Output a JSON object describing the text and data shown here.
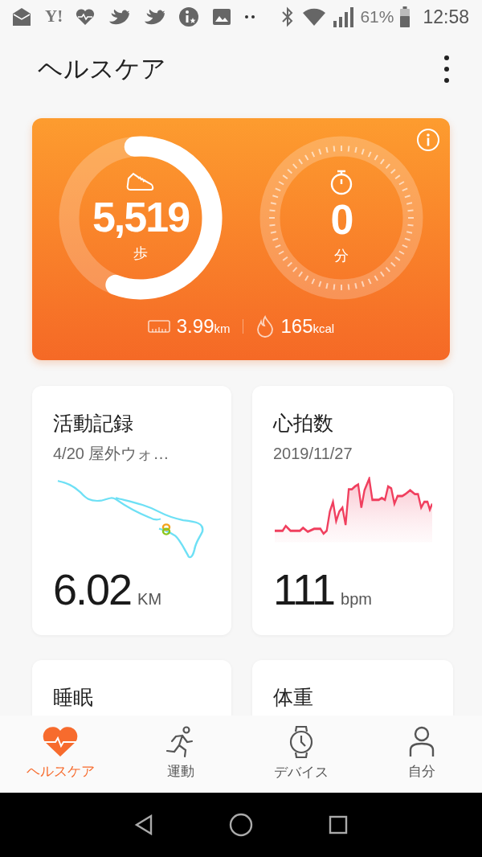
{
  "status_bar": {
    "logo_text": "Y!",
    "battery": "61%",
    "time": "12:58"
  },
  "header": {
    "title": "ヘルスケア"
  },
  "summary": {
    "steps": "5,519",
    "steps_unit": "歩",
    "steps_progress": {
      "level": 0.57
    },
    "minutes": "0",
    "minutes_unit": "分",
    "distance": "3.99",
    "distance_unit": "km",
    "calories": "165",
    "calories_unit": "kcal"
  },
  "cards": [
    {
      "kind": "route",
      "title": "活動記録",
      "subtitle": "4/20 屋外ウォ…",
      "value": "6.02",
      "unit": "KM"
    },
    {
      "kind": "heart",
      "title": "心拍数",
      "subtitle": "2019/11/27",
      "value": "111",
      "unit": "bpm"
    },
    {
      "kind": "plain",
      "title": "睡眠"
    },
    {
      "kind": "plain",
      "title": "体重"
    }
  ],
  "tabs": [
    {
      "kind": "health",
      "label": "ヘルスケア",
      "selected": true
    },
    {
      "kind": "exercise",
      "label": "運動",
      "selected": false
    },
    {
      "kind": "device",
      "label": "デバイス",
      "selected": false
    },
    {
      "kind": "me",
      "label": "自分",
      "selected": false
    }
  ]
}
